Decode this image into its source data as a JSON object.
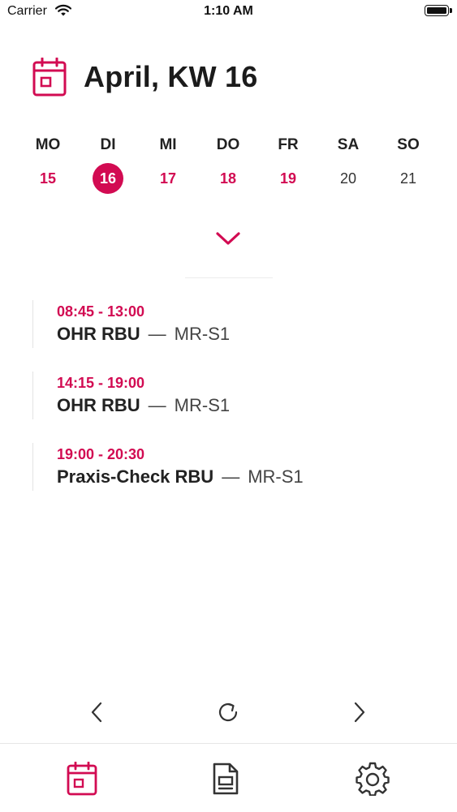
{
  "status_bar": {
    "carrier": "Carrier",
    "time": "1:10 AM"
  },
  "header": {
    "title": "April, KW 16",
    "icon": "calendar-icon"
  },
  "week": {
    "days": [
      {
        "label": "MO",
        "number": "15",
        "state": "active"
      },
      {
        "label": "DI",
        "number": "16",
        "state": "selected"
      },
      {
        "label": "MI",
        "number": "17",
        "state": "active"
      },
      {
        "label": "DO",
        "number": "18",
        "state": "active"
      },
      {
        "label": "FR",
        "number": "19",
        "state": "active"
      },
      {
        "label": "SA",
        "number": "20",
        "state": "inactive"
      },
      {
        "label": "SO",
        "number": "21",
        "state": "inactive"
      }
    ]
  },
  "appointments": [
    {
      "time": "08:45 - 13:00",
      "title": "OHR RBU",
      "separator": "—",
      "room": "MR-S1"
    },
    {
      "time": "14:15 - 19:00",
      "title": "OHR RBU",
      "separator": "—",
      "room": "MR-S1"
    },
    {
      "time": "19:00 - 20:30",
      "title": "Praxis-Check RBU",
      "separator": "—",
      "room": "MR-S1"
    }
  ],
  "nav": {
    "prev_icon": "chevron-left-icon",
    "refresh_icon": "refresh-icon",
    "next_icon": "chevron-right-icon"
  },
  "tabs": [
    {
      "icon": "calendar-icon",
      "selected": true
    },
    {
      "icon": "document-icon",
      "selected": false
    },
    {
      "icon": "gear-icon",
      "selected": false
    }
  ],
  "colors": {
    "accent": "#d20b52",
    "text": "#222222",
    "muted": "#444444"
  }
}
